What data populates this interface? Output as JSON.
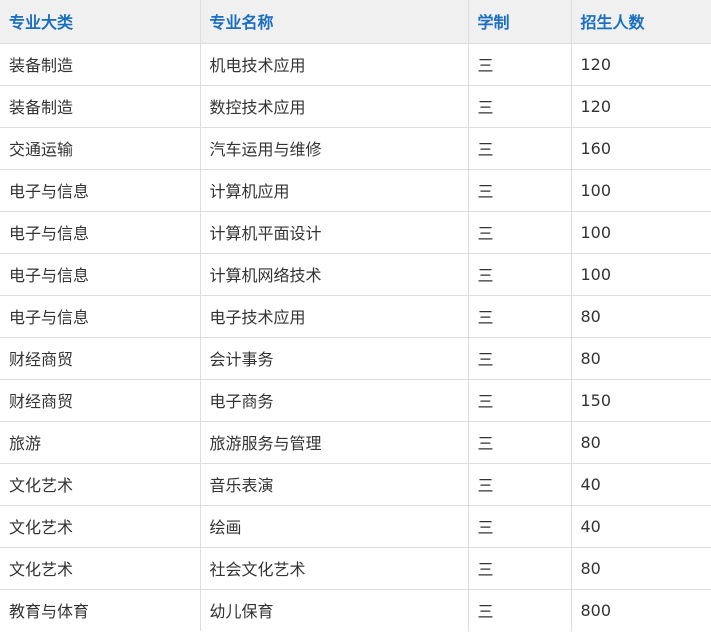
{
  "table": {
    "headers": [
      "专业大类",
      "专业名称",
      "学制",
      "招生人数"
    ],
    "rows": [
      [
        "装备制造",
        "机电技术应用",
        "三",
        "120"
      ],
      [
        "装备制造",
        "数控技术应用",
        "三",
        "120"
      ],
      [
        "交通运输",
        "汽车运用与维修",
        "三",
        "160"
      ],
      [
        "电子与信息",
        "计算机应用",
        "三",
        "100"
      ],
      [
        "电子与信息",
        "计算机平面设计",
        "三",
        "100"
      ],
      [
        "电子与信息",
        "计算机网络技术",
        "三",
        "100"
      ],
      [
        "电子与信息",
        "电子技术应用",
        "三",
        "80"
      ],
      [
        "财经商贸",
        "会计事务",
        "三",
        "80"
      ],
      [
        "财经商贸",
        "电子商务",
        "三",
        "150"
      ],
      [
        "旅游",
        "旅游服务与管理",
        "三",
        "80"
      ],
      [
        "文化艺术",
        "音乐表演",
        "三",
        "40"
      ],
      [
        "文化艺术",
        "绘画",
        "三",
        "40"
      ],
      [
        "文化艺术",
        "社会文化艺术",
        "三",
        "80"
      ],
      [
        "教育与体育",
        "幼儿保育",
        "三",
        "800"
      ]
    ]
  },
  "colors": {
    "header_text": "#1a6fc0",
    "header_bg": "#f0f0f0",
    "border": "#dddddd",
    "body_text": "#333333"
  }
}
